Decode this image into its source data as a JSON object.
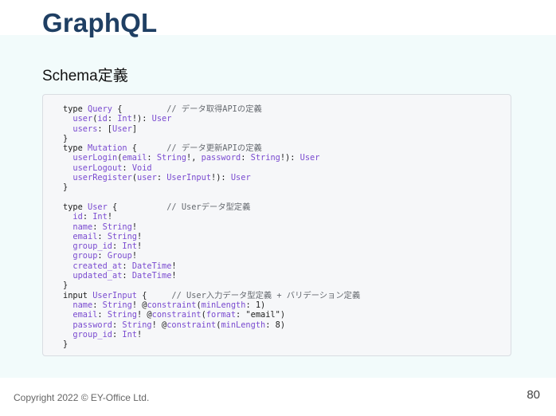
{
  "slide": {
    "title": "GraphQL",
    "subtitle": "Schema定義",
    "footer": "Copyright 2022 © EY-Office Ltd.",
    "page_number": "80"
  },
  "code": {
    "lines": [
      [
        [
          "kw",
          "type "
        ],
        [
          "type",
          "Query"
        ],
        [
          "kw",
          " {         "
        ],
        [
          "comment",
          "// データ取得APIの定義"
        ]
      ],
      [
        [
          "kw",
          "  "
        ],
        [
          "type",
          "user"
        ],
        [
          "kw",
          "("
        ],
        [
          "type",
          "id"
        ],
        [
          "kw",
          ": "
        ],
        [
          "type",
          "Int"
        ],
        [
          "kw",
          "!): "
        ],
        [
          "type",
          "User"
        ]
      ],
      [
        [
          "kw",
          "  "
        ],
        [
          "type",
          "users"
        ],
        [
          "kw",
          ": ["
        ],
        [
          "type",
          "User"
        ],
        [
          "kw",
          "]"
        ]
      ],
      [
        [
          "kw",
          "}"
        ]
      ],
      [
        [
          "kw",
          "type "
        ],
        [
          "type",
          "Mutation"
        ],
        [
          "kw",
          " {      "
        ],
        [
          "comment",
          "// データ更新APIの定義"
        ]
      ],
      [
        [
          "kw",
          "  "
        ],
        [
          "type",
          "userLogin"
        ],
        [
          "kw",
          "("
        ],
        [
          "type",
          "email"
        ],
        [
          "kw",
          ": "
        ],
        [
          "type",
          "String"
        ],
        [
          "kw",
          "!, "
        ],
        [
          "type",
          "password"
        ],
        [
          "kw",
          ": "
        ],
        [
          "type",
          "String"
        ],
        [
          "kw",
          "!): "
        ],
        [
          "type",
          "User"
        ]
      ],
      [
        [
          "kw",
          "  "
        ],
        [
          "type",
          "userLogout"
        ],
        [
          "kw",
          ": "
        ],
        [
          "type",
          "Void"
        ]
      ],
      [
        [
          "kw",
          "  "
        ],
        [
          "type",
          "userRegister"
        ],
        [
          "kw",
          "("
        ],
        [
          "type",
          "user"
        ],
        [
          "kw",
          ": "
        ],
        [
          "type",
          "UserInput"
        ],
        [
          "kw",
          "!): "
        ],
        [
          "type",
          "User"
        ]
      ],
      [
        [
          "kw",
          "}"
        ]
      ],
      [
        [
          "kw",
          ""
        ]
      ],
      [
        [
          "kw",
          "type "
        ],
        [
          "type",
          "User"
        ],
        [
          "kw",
          " {          "
        ],
        [
          "comment",
          "// Userデータ型定義"
        ]
      ],
      [
        [
          "kw",
          "  "
        ],
        [
          "type",
          "id"
        ],
        [
          "kw",
          ": "
        ],
        [
          "type",
          "Int"
        ],
        [
          "kw",
          "!"
        ]
      ],
      [
        [
          "kw",
          "  "
        ],
        [
          "type",
          "name"
        ],
        [
          "kw",
          ": "
        ],
        [
          "type",
          "String"
        ],
        [
          "kw",
          "!"
        ]
      ],
      [
        [
          "kw",
          "  "
        ],
        [
          "type",
          "email"
        ],
        [
          "kw",
          ": "
        ],
        [
          "type",
          "String"
        ],
        [
          "kw",
          "!"
        ]
      ],
      [
        [
          "kw",
          "  "
        ],
        [
          "type",
          "group_id"
        ],
        [
          "kw",
          ": "
        ],
        [
          "type",
          "Int"
        ],
        [
          "kw",
          "!"
        ]
      ],
      [
        [
          "kw",
          "  "
        ],
        [
          "type",
          "group"
        ],
        [
          "kw",
          ": "
        ],
        [
          "type",
          "Group"
        ],
        [
          "kw",
          "!"
        ]
      ],
      [
        [
          "kw",
          "  "
        ],
        [
          "type",
          "created_at"
        ],
        [
          "kw",
          ": "
        ],
        [
          "type",
          "DateTime"
        ],
        [
          "kw",
          "!"
        ]
      ],
      [
        [
          "kw",
          "  "
        ],
        [
          "type",
          "updated_at"
        ],
        [
          "kw",
          ": "
        ],
        [
          "type",
          "DateTime"
        ],
        [
          "kw",
          "!"
        ]
      ],
      [
        [
          "kw",
          "}"
        ]
      ],
      [
        [
          "kw",
          "input "
        ],
        [
          "type",
          "UserInput"
        ],
        [
          "kw",
          " {     "
        ],
        [
          "comment",
          "// User入力データ型定義 + バリデーション定義"
        ]
      ],
      [
        [
          "kw",
          "  "
        ],
        [
          "type",
          "name"
        ],
        [
          "kw",
          ": "
        ],
        [
          "type",
          "String"
        ],
        [
          "kw",
          "! @"
        ],
        [
          "type",
          "constraint"
        ],
        [
          "kw",
          "("
        ],
        [
          "type",
          "minLength"
        ],
        [
          "kw",
          ": 1)"
        ]
      ],
      [
        [
          "kw",
          "  "
        ],
        [
          "type",
          "email"
        ],
        [
          "kw",
          ": "
        ],
        [
          "type",
          "String"
        ],
        [
          "kw",
          "! @"
        ],
        [
          "type",
          "constraint"
        ],
        [
          "kw",
          "("
        ],
        [
          "type",
          "format"
        ],
        [
          "kw",
          ": \"email\")"
        ]
      ],
      [
        [
          "kw",
          "  "
        ],
        [
          "type",
          "password"
        ],
        [
          "kw",
          ": "
        ],
        [
          "type",
          "String"
        ],
        [
          "kw",
          "! @"
        ],
        [
          "type",
          "constraint"
        ],
        [
          "kw",
          "("
        ],
        [
          "type",
          "minLength"
        ],
        [
          "kw",
          ": 8)"
        ]
      ],
      [
        [
          "kw",
          "  "
        ],
        [
          "type",
          "group_id"
        ],
        [
          "kw",
          ": "
        ],
        [
          "type",
          "Int"
        ],
        [
          "kw",
          "!"
        ]
      ],
      [
        [
          "kw",
          "}"
        ]
      ]
    ]
  },
  "colors": {
    "title": "#1f3f63",
    "background_band": "#f2fbfb",
    "code_type": "#7a4bd0",
    "code_comment": "#666a70"
  }
}
